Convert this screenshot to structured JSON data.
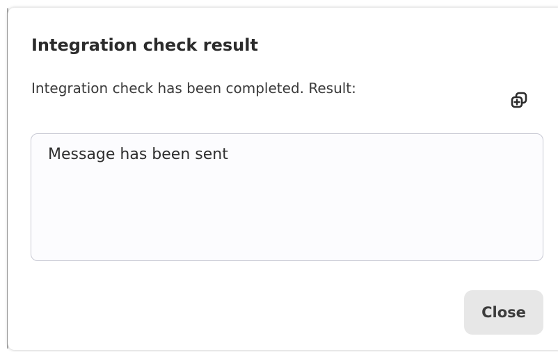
{
  "dialog": {
    "title": "Integration check result",
    "message": "Integration check has been completed. Result:",
    "copy_icon": "copy-icon",
    "result_text": "Message has been sent",
    "close_label": "Close"
  },
  "colors": {
    "title": "#2b2b2b",
    "text": "#3a3a3a",
    "result_border": "#c8c9d4",
    "button_background": "#e7e7e7"
  }
}
